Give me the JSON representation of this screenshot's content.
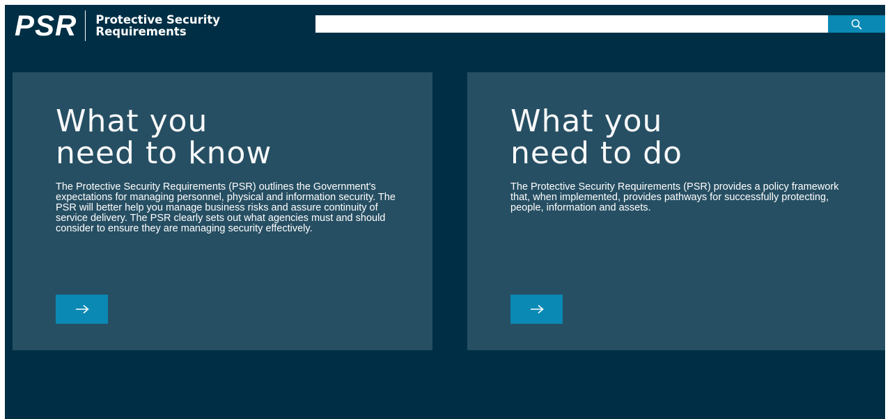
{
  "header": {
    "logo": {
      "mark": "PSR",
      "line1": "Protective Security",
      "line2": "Requirements"
    },
    "search": {
      "value": "",
      "placeholder": "",
      "button_icon": "search-icon"
    }
  },
  "cards": [
    {
      "title_line1": "What you",
      "title_line2": "need to know",
      "description": "The Protective Security Requirements (PSR) outlines the Government's expectations for managing personnel, physical and information security. The PSR will better help you manage business risks and assure continuity of service delivery. The PSR clearly sets out what agencies must and should consider to ensure they are managing security effectively.",
      "button_icon": "arrow-right-icon"
    },
    {
      "title_line1": "What you",
      "title_line2": "need to do",
      "description": "The Protective Security Requirements (PSR) provides a policy framework that, when implemented, provides pathways for successfully protecting, people, information and assets.",
      "button_icon": "arrow-right-icon"
    }
  ],
  "colors": {
    "page_background": "#002f45",
    "card_background": "#274f63",
    "accent": "#0a89b4",
    "text": "#ffffff"
  }
}
